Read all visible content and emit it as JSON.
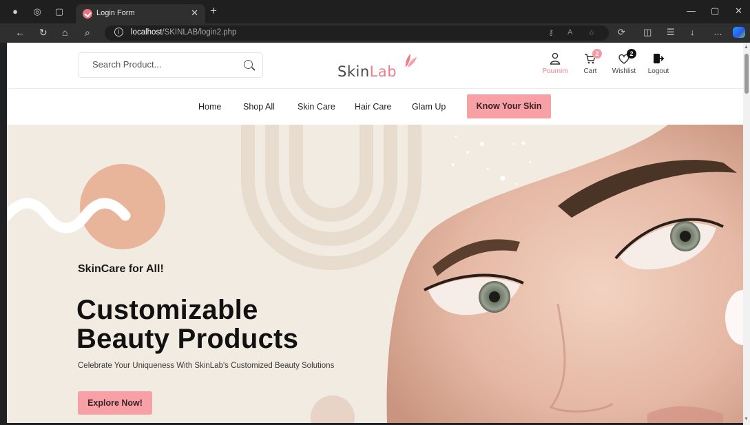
{
  "browser": {
    "tab_title": "Login Form",
    "url_host": "localhost",
    "url_path": "/SKINLAB/login2.php"
  },
  "site": {
    "logo_part1": "Skin",
    "logo_part2": "Lab",
    "search_placeholder": "Search Product...",
    "header_icons": {
      "user_label": "Pournim",
      "cart_label": "Cart",
      "cart_count": "2",
      "wishlist_label": "Wishlist",
      "wishlist_count": "2",
      "logout_label": "Logout"
    },
    "menu": [
      "Home",
      "Shop All",
      "Skin Care",
      "Hair Care",
      "Glam Up"
    ],
    "menu_cta": "Know Your Skin"
  },
  "hero": {
    "tagline": "SkinCare for All!",
    "headline_line1": "Customizable",
    "headline_line2": "Beauty Products",
    "subline": "Celebrate Your Uniqueness With SkinLab's Customized Beauty Solutions",
    "cta": "Explore Now!"
  },
  "colors": {
    "accent_pink": "#f7a1a7",
    "hero_bg": "#f1ebe1",
    "peach_circle": "#e8b49a"
  }
}
